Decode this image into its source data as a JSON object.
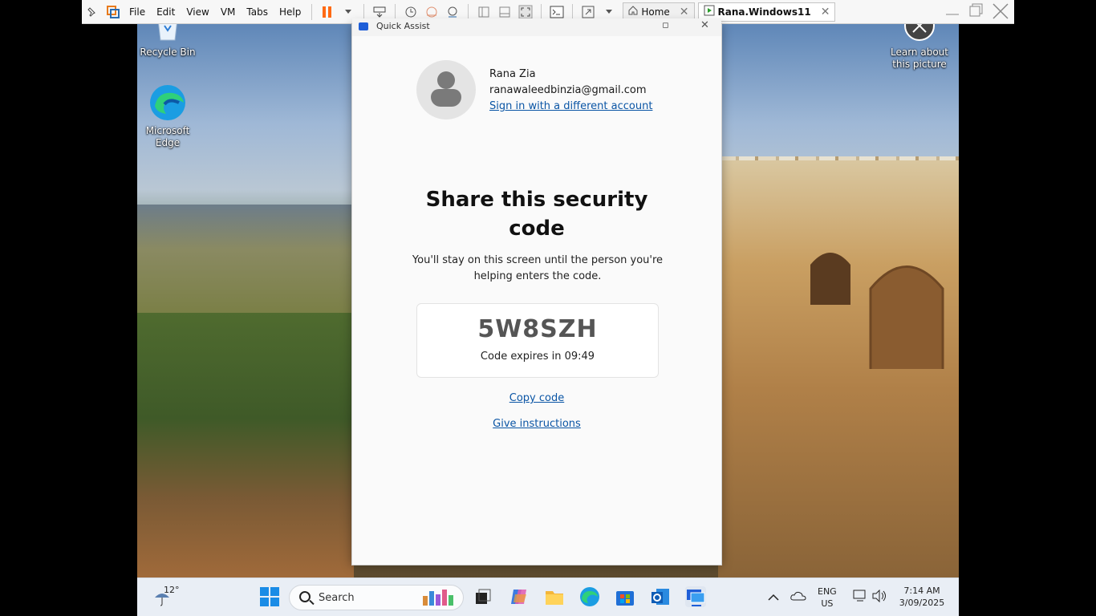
{
  "vm_toolbar": {
    "menus": [
      "File",
      "Edit",
      "View",
      "VM",
      "Tabs",
      "Help"
    ],
    "tabs": [
      {
        "label": "Home"
      },
      {
        "label": "Rana.Windows11"
      }
    ],
    "colors": {
      "pause": "#ff6a13",
      "vmware_logo": "#e87a1c"
    }
  },
  "desktop": {
    "icons": [
      {
        "label": "Recycle Bin"
      },
      {
        "label": "Microsoft Edge"
      },
      {
        "label": "Learn about this picture"
      }
    ]
  },
  "quick_assist": {
    "window_title": "Quick Assist",
    "account": {
      "name": "Rana Zia",
      "email": "ranawaleedbinzia@gmail.com",
      "switch_link": "Sign in with a different account"
    },
    "heading": "Share this security code",
    "description": "You'll stay on this screen until the person you're helping enters the code.",
    "code": "5W8SZH",
    "expires": "Code expires in 09:49",
    "copy_link": "Copy code",
    "instructions_link": "Give instructions"
  },
  "taskbar": {
    "weather_temp": "12°",
    "search_placeholder": "Search",
    "language": "ENG",
    "region": "US",
    "time": "7:14 AM",
    "date": "3/09/2025",
    "pinned_icons": [
      "task-view-icon",
      "copilot-icon",
      "file-explorer-icon",
      "edge-icon",
      "store-icon",
      "outlook-icon",
      "quick-assist-icon"
    ]
  }
}
